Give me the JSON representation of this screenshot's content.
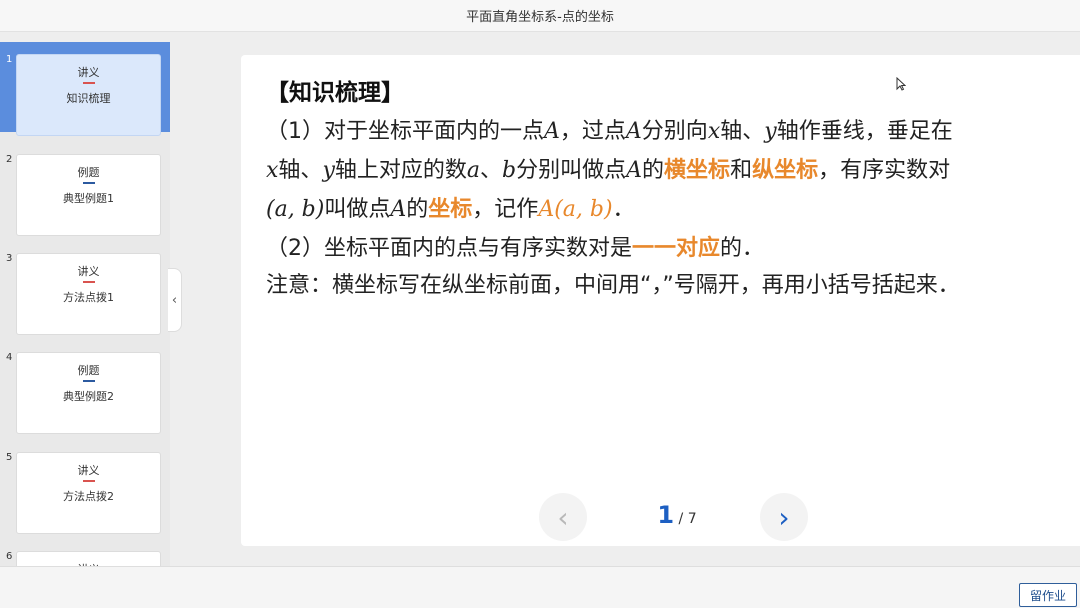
{
  "window": {
    "title": "平面直角坐标系-点的坐标"
  },
  "sidebar": {
    "collapse_icon": "chevron-left-icon",
    "collapse_glyph": "‹",
    "slides": [
      {
        "num": "1",
        "type": "讲义",
        "name": "知识梳理",
        "dash_color": "#d9534f",
        "active": true
      },
      {
        "num": "2",
        "type": "例题",
        "name": "典型例题1",
        "dash_color": "#2c5aa0",
        "active": false
      },
      {
        "num": "3",
        "type": "讲义",
        "name": "方法点拨1",
        "dash_color": "#d9534f",
        "active": false
      },
      {
        "num": "4",
        "type": "例题",
        "name": "典型例题2",
        "dash_color": "#2c5aa0",
        "active": false
      },
      {
        "num": "5",
        "type": "讲义",
        "name": "方法点拨2",
        "dash_color": "#d9534f",
        "active": false
      },
      {
        "num": "6",
        "type": "讲义",
        "name": "",
        "dash_color": "#d9534f",
        "active": false
      }
    ]
  },
  "content": {
    "section_title": "【知识梳理】",
    "line1": {
      "a": "（1）对于坐标平面内的一点",
      "m1": "A",
      "b": "，过点",
      "m2": "A",
      "c": "分别向",
      "m3": "x",
      "d": "轴、",
      "m4": "y",
      "e": "轴作垂线，垂足在"
    },
    "line2": {
      "m1": "x",
      "a": "轴、",
      "m2": "y",
      "b": "轴上对应的数",
      "m3": "a",
      "c": "、",
      "m4": "b",
      "d": "分别叫做点",
      "m5": "A",
      "e": "的",
      "hl1": "横坐标",
      "f": "和",
      "hl2": "纵坐标",
      "g": "，有序实数对"
    },
    "line3": {
      "m1": "(a, b)",
      "a": "叫做点",
      "m2": "A",
      "b": "的",
      "hl1": "坐标",
      "c": "，记作",
      "hm1": "A(a, b)",
      "d": "．"
    },
    "line4": {
      "a": "（2）坐标平面内的点与有序实数对是",
      "hl1": "一一对应",
      "b": "的．"
    },
    "line5": "注意：横坐标写在纵坐标前面，中间用“，”号隔开，再用小括号括起来．",
    "highlight_color": "#e8882c"
  },
  "pager": {
    "prev_icon": "chevron-left-icon",
    "prev_glyph": "‹",
    "next_icon": "chevron-right-icon",
    "next_glyph": "›",
    "current": "1",
    "total_text": " / 7",
    "accent": "#1d5fc2"
  },
  "bottom": {
    "homework_label": "留作业"
  }
}
